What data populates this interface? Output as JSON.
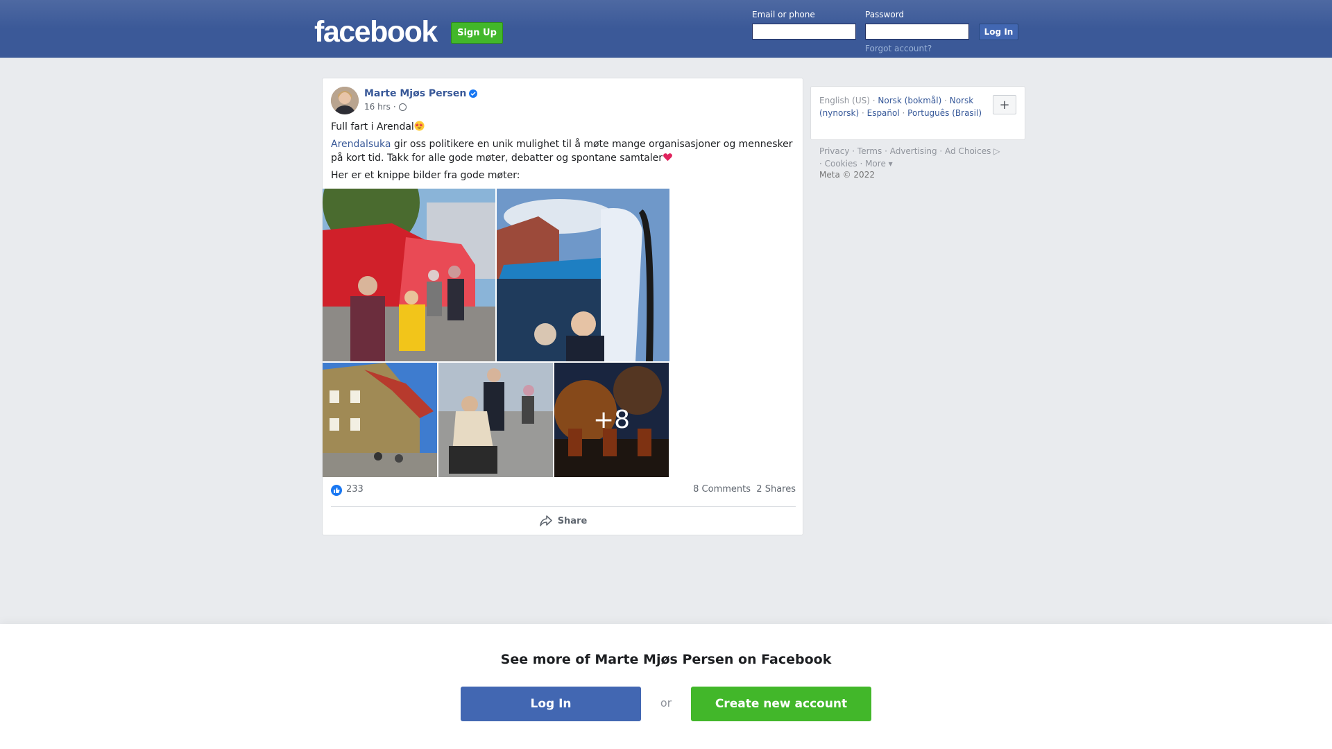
{
  "header": {
    "logo": "facebook",
    "signup_label": "Sign Up",
    "email_label": "Email or phone",
    "email_value": "",
    "password_label": "Password",
    "password_value": "",
    "login_label": "Log In",
    "forgot_label": "Forgot account?"
  },
  "post": {
    "author": "Marte Mjøs Persen",
    "time": "16 hrs",
    "line1": "Full fart i Arendal",
    "line2_link": "Arendalsuka",
    "line2_rest": " gir oss politikere en unik mulighet til å møte mange organisasjoner og mennesker på kort tid. Takk for alle gode møter, debatter og spontane samtaler",
    "line3": "Her er et knippe bilder fra gode møter:",
    "more_photos": "+8",
    "likes": "233",
    "comments": "8 Comments",
    "shares": "2 Shares",
    "share_label": "Share"
  },
  "languages": {
    "current": "English (US)",
    "items": [
      "Norsk (bokmål)",
      "Norsk (nynorsk)",
      "Español",
      "Português (Brasil)"
    ],
    "more_button": "+"
  },
  "footer": {
    "links": [
      "Privacy",
      "Terms",
      "Advertising",
      "Ad Choices",
      "Cookies",
      "More"
    ],
    "copyright": "Meta © 2022"
  },
  "bottom": {
    "title": "See more of Marte Mjøs Persen on Facebook",
    "login_label": "Log In",
    "or_label": "or",
    "create_label": "Create new account"
  },
  "colors": {
    "header_bg": "#3b5998",
    "link": "#385898",
    "green": "#42b72a",
    "blue_button": "#4267b2"
  }
}
